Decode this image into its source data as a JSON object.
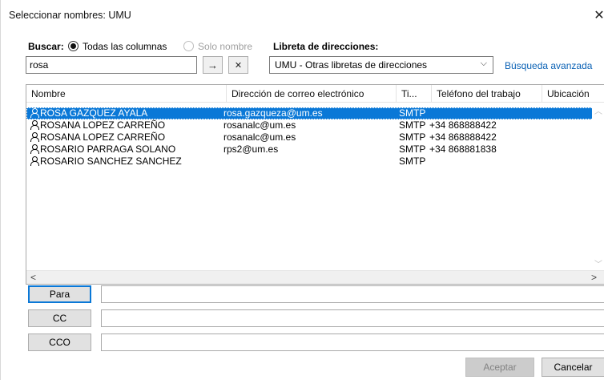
{
  "title": "Seleccionar nombres: UMU",
  "close_glyph": "✕",
  "search": {
    "label": "Buscar:",
    "option_all": "Todas las columnas",
    "option_name": "Solo nombre",
    "value": "rosa",
    "go_glyph": "→",
    "clear_glyph": "✕"
  },
  "addressbook": {
    "label": "Libreta de direcciones:",
    "selected": "UMU - Otras libretas de direcciones",
    "advanced_link": "Búsqueda avanzada"
  },
  "columns": [
    "Nombre",
    "Dirección de correo electrónico",
    "Ti...",
    "Teléfono del trabajo",
    "Ubicación"
  ],
  "rows": [
    {
      "name": "ROSA GAZQUEZ AYALA",
      "email": "rosa.gazqueza@um.es",
      "type": "SMTP",
      "phone": "",
      "location": "",
      "selected": true
    },
    {
      "name": "ROSANA LOPEZ CARREÑO",
      "email": "rosanalc@um.es",
      "type": "SMTP",
      "phone": "+34 868888422",
      "location": ""
    },
    {
      "name": "ROSANA LOPEZ CARREÑO",
      "email": "rosanalc@um.es",
      "type": "SMTP",
      "phone": "+34 868888422",
      "location": ""
    },
    {
      "name": "ROSARIO PARRAGA SOLANO",
      "email": "rps2@um.es",
      "type": "SMTP",
      "phone": "+34 868881838",
      "location": ""
    },
    {
      "name": "ROSARIO SANCHEZ SANCHEZ",
      "email": "",
      "type": "SMTP",
      "phone": "",
      "location": ""
    }
  ],
  "recipients": {
    "to_label": "Para",
    "cc_label": "CC",
    "bcc_label": "CCO",
    "to_value": "",
    "cc_value": "",
    "bcc_value": ""
  },
  "buttons": {
    "ok": "Aceptar",
    "cancel": "Cancelar"
  },
  "colors": {
    "selection": "#0a78d7",
    "link": "#0b62b5"
  }
}
